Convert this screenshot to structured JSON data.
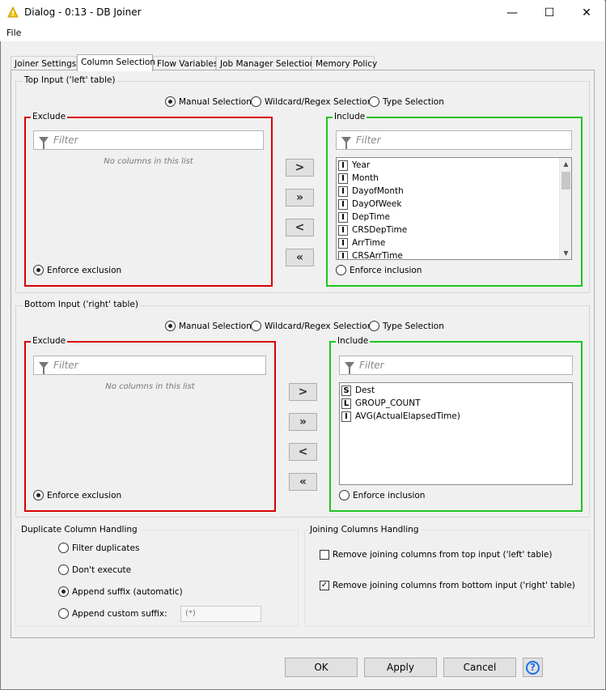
{
  "window": {
    "title": "Dialog - 0:13 - DB Joiner",
    "minimize": "—",
    "maximize": "☐",
    "close": "✕",
    "app_icon": "knime-warning-icon"
  },
  "menu": {
    "file": "File"
  },
  "tabs": [
    {
      "label": "Joiner Settings",
      "active": false
    },
    {
      "label": "Column Selection",
      "active": true
    },
    {
      "label": "Flow Variables",
      "active": false
    },
    {
      "label": "Job Manager Selection",
      "active": false
    },
    {
      "label": "Memory Policy",
      "active": false
    }
  ],
  "top": {
    "title": "Top Input ('left' table)",
    "modes": [
      "Manual Selection",
      "Wildcard/Regex Selection",
      "Type Selection"
    ],
    "selected_mode": 0,
    "exclude": {
      "title": "Exclude",
      "filter_placeholder": "Filter",
      "empty_message": "No columns in this list",
      "enforce_label": "Enforce exclusion"
    },
    "include": {
      "title": "Include",
      "filter_placeholder": "Filter",
      "enforce_label": "Enforce inclusion",
      "items": [
        {
          "type": "I",
          "name": "Year"
        },
        {
          "type": "I",
          "name": "Month"
        },
        {
          "type": "I",
          "name": "DayofMonth"
        },
        {
          "type": "I",
          "name": "DayOfWeek"
        },
        {
          "type": "I",
          "name": "DepTime"
        },
        {
          "type": "I",
          "name": "CRSDepTime"
        },
        {
          "type": "I",
          "name": "ArrTime"
        },
        {
          "type": "I",
          "name": "CRSArrTime"
        }
      ]
    },
    "enforce_exclusion_selected": true
  },
  "bottom": {
    "title": "Bottom Input ('right' table)",
    "modes": [
      "Manual Selection",
      "Wildcard/Regex Selection",
      "Type Selection"
    ],
    "selected_mode": 0,
    "exclude": {
      "title": "Exclude",
      "filter_placeholder": "Filter",
      "empty_message": "No columns in this list",
      "enforce_label": "Enforce exclusion"
    },
    "include": {
      "title": "Include",
      "filter_placeholder": "Filter",
      "enforce_label": "Enforce inclusion",
      "items": [
        {
          "type": "S",
          "name": "Dest"
        },
        {
          "type": "L",
          "name": "GROUP_COUNT"
        },
        {
          "type": "I",
          "name": "AVG(ActualElapsedTime)"
        }
      ]
    },
    "enforce_exclusion_selected": true
  },
  "move_buttons": {
    "add": ">",
    "add_all": "»",
    "remove": "<",
    "remove_all": "«"
  },
  "duplicate": {
    "title": "Duplicate Column Handling",
    "options": [
      "Filter duplicates",
      "Don't execute",
      "Append suffix (automatic)",
      "Append custom suffix:"
    ],
    "selected": 2,
    "custom_suffix_value": "(*)"
  },
  "joining": {
    "title": "Joining Columns Handling",
    "remove_top_label": "Remove joining columns from top input ('left' table)",
    "remove_top_checked": false,
    "remove_bottom_label": "Remove joining columns from bottom input ('right' table)",
    "remove_bottom_checked": true
  },
  "buttons": {
    "ok": "OK",
    "apply": "Apply",
    "cancel": "Cancel",
    "help_icon": "help-icon",
    "help_glyph": "?"
  }
}
